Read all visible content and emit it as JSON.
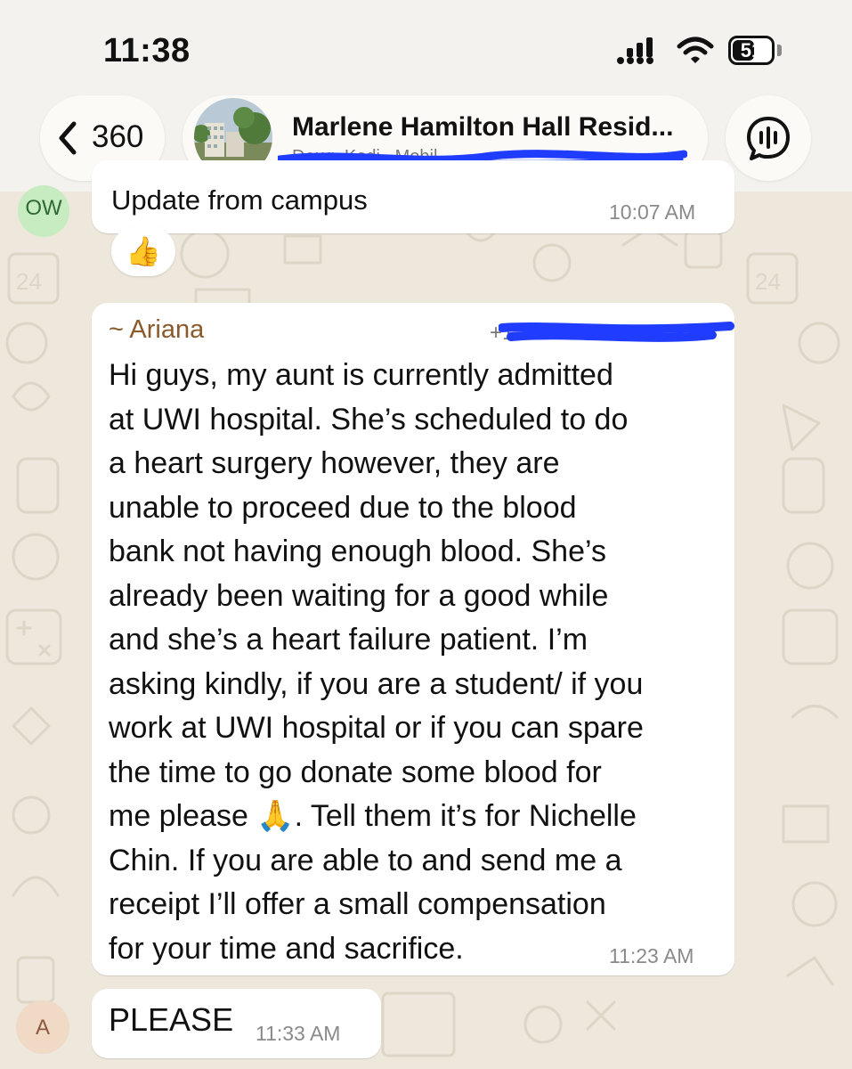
{
  "status_bar": {
    "time": "11:38",
    "battery": "51"
  },
  "header": {
    "back_count": "360",
    "group_name": "Marlene Hamilton Hall Resid...",
    "subtitle": "Doug, Kodi...Mobil..."
  },
  "messages": [
    {
      "sender_initials": "OW",
      "text": "Update from campus",
      "time": "10:07 AM",
      "reaction": "👍"
    },
    {
      "sender": "~ Ariana",
      "phone": "+1",
      "text": "Hi guys, my aunt is currently admitted\nat UWI hospital. She’s scheduled to do\na heart surgery however, they are\nunable to proceed due to the blood\nbank not having enough blood. She’s\nalready been waiting for a good while\nand she’s a heart failure patient. I’m\nasking kindly, if you are a student/ if you\nwork at UWI hospital or if you can spare\nthe time to go donate some blood for\nme please 🙏. Tell them it’s for Nichelle\nChin. If you are able to and send me a\nreceipt I’ll offer a small compensation\nfor your time and sacrifice.",
      "time": "11:23 AM"
    },
    {
      "sender_initials": "A",
      "text": "PLEASE",
      "time": "11:33 AM"
    }
  ],
  "colors": {
    "background": "#f1ece2",
    "bubble": "#ffffff",
    "sender_name": "#8a5a2b",
    "redaction": "#1f3cff"
  },
  "icons": [
    "chevron-left-icon",
    "signal-icon",
    "wifi-icon",
    "battery-icon",
    "voice-call-icon"
  ]
}
